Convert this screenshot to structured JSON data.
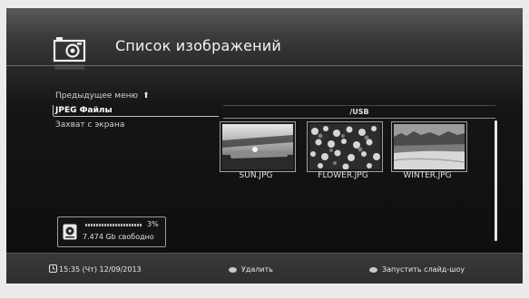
{
  "header": {
    "title": "Список изображений",
    "icon": "camera-icon"
  },
  "menu": {
    "items": [
      {
        "label": "Предыдущее меню",
        "icon": "arrow-up-icon",
        "arrow": "⬆"
      },
      {
        "label": "JPEG Файлы",
        "selected": true
      },
      {
        "label": "Захват с экрана"
      }
    ]
  },
  "browser": {
    "path": "/USB",
    "files": [
      {
        "name": "SUN.JPG",
        "icon": "sun-thumbnail"
      },
      {
        "name": "FLOWER.JPG",
        "icon": "flower-thumbnail"
      },
      {
        "name": "WINTER.JPG",
        "icon": "winter-thumbnail"
      }
    ]
  },
  "storage": {
    "icon": "hdd-icon",
    "used_percent": 3,
    "used_label": "3%",
    "free_label": "7.474 Gb свободно"
  },
  "footer": {
    "datetime": "15:35 (Чт) 12/09/2013",
    "delete_label": "Удалить",
    "slideshow_label": "Запустить слайд-шоу"
  },
  "colors": {
    "background_top": "#595959",
    "background_bottom": "#0d0d0d",
    "text": "#e0e0e0",
    "footer": "#3a3a3a"
  }
}
